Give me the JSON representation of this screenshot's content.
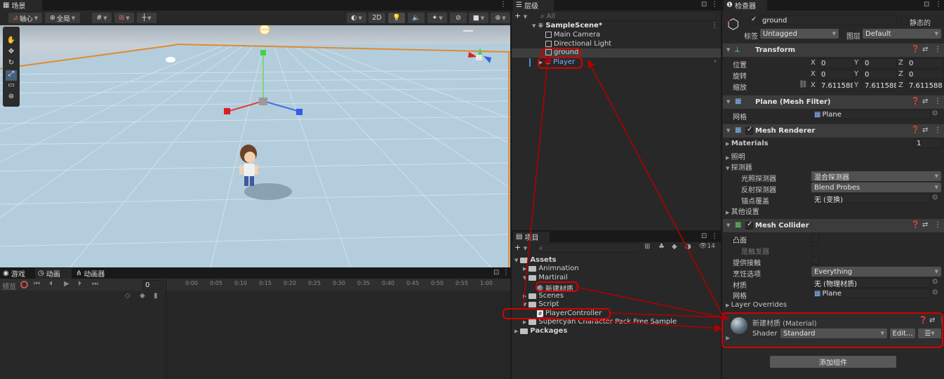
{
  "scene": {
    "tab": "场景",
    "pivot": "轴心",
    "global": "全局",
    "mode_2d": "2D"
  },
  "hierarchy": {
    "tab": "层级",
    "search_placeholder": "All",
    "scene_name": "SampleScene*",
    "items": [
      "Main Camera",
      "Directional Light",
      "ground",
      "Player"
    ]
  },
  "project": {
    "tab": "项目",
    "count": "14",
    "tree": {
      "assets": "Assets",
      "animnation": "Animnation",
      "martirail": "Martirail",
      "material": "新建材质",
      "scenes": "Scenes",
      "script": "Script",
      "player_controller": "PlayerController",
      "supercyan": "Supercyan Character Pack Free Sample",
      "packages": "Packages"
    }
  },
  "bottom": {
    "tab_game": "游戏",
    "tab_animation": "动画",
    "tab_animator": "动画器",
    "preview": "预览",
    "frame": "0",
    "ruler": [
      "0:00",
      "0:05",
      "0:10",
      "0:15",
      "0:20",
      "0:25",
      "0:30",
      "0:35",
      "0:40",
      "0:45",
      "0:50",
      "0:55",
      "1:00"
    ]
  },
  "inspector": {
    "tab": "检查器",
    "object_name": "ground",
    "static_label": "静态的",
    "tag_label": "标签",
    "tag_value": "Untagged",
    "layer_label": "图层",
    "layer_value": "Default",
    "transform": {
      "title": "Transform",
      "position_label": "位置",
      "rotation_label": "旋转",
      "scale_label": "缩放",
      "position": [
        "0",
        "0",
        "0"
      ],
      "rotation": [
        "0",
        "0",
        "0"
      ],
      "scale": [
        "7.611588",
        "7.611588",
        "7.611588"
      ],
      "axis": [
        "X",
        "Y",
        "Z"
      ]
    },
    "mesh_filter": {
      "title": "Plane (Mesh Filter)",
      "mesh_label": "网格",
      "mesh_value": "Plane"
    },
    "mesh_renderer": {
      "title": "Mesh Renderer",
      "materials_label": "Materials",
      "materials_count": "1",
      "lighting": "照明",
      "probes": "探测器",
      "light_probes_label": "光照探测器",
      "light_probes_value": "混合探测器",
      "reflection_probes_label": "反射探测器",
      "reflection_probes_value": "Blend Probes",
      "anchor_label": "锚点覆盖",
      "anchor_value": "无 (变换)",
      "other": "其他设置"
    },
    "mesh_collider": {
      "title": "Mesh Collider",
      "convex": "凸面",
      "is_trigger": "是触发器",
      "contacts": "提供接触",
      "cooking_label": "烹饪选项",
      "cooking_value": "Everything",
      "material_label": "材质",
      "material_value": "无 (物理材质)",
      "mesh_label": "网格",
      "mesh_value": "Plane",
      "layer_overrides": "Layer Overrides"
    },
    "material": {
      "title": "新建材质 (Material)",
      "shader_label": "Shader",
      "shader_value": "Standard",
      "edit": "Edit..."
    },
    "add_component": "添加组件"
  },
  "colors": {
    "annotation": "#d40000",
    "selection": "#2c5d87",
    "player_text": "#7cb3ff"
  }
}
